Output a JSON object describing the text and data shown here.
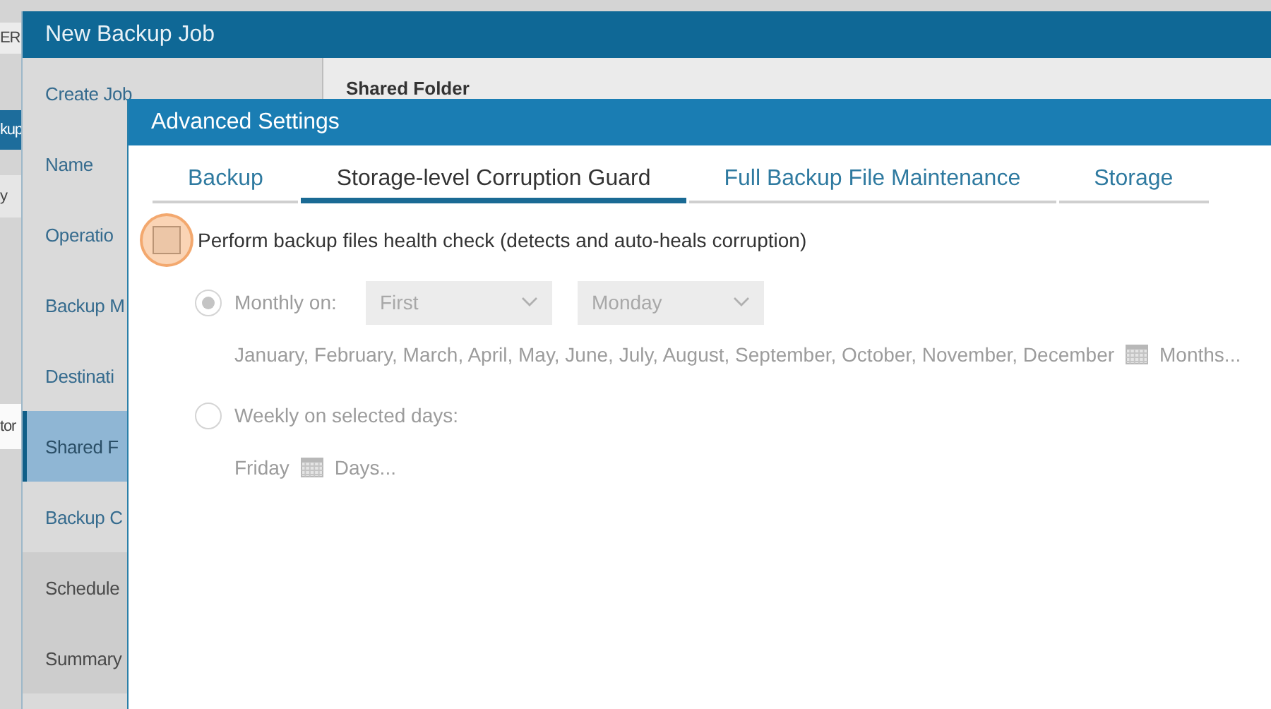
{
  "background_app": {
    "fragments": [
      {
        "text": "ER",
        "kind": "plain"
      },
      {
        "text": "kup",
        "kind": "bar"
      },
      {
        "text": "y",
        "kind": "plain"
      },
      {
        "text": "tor",
        "kind": "field"
      }
    ]
  },
  "job_window": {
    "title": "New Backup Job",
    "section_title": "Shared Folder",
    "steps": [
      {
        "label": "Create Job",
        "selected": false,
        "completed": true
      },
      {
        "label": "Name",
        "selected": false,
        "completed": true
      },
      {
        "label": "Operatio",
        "selected": false,
        "completed": true
      },
      {
        "label": "Backup M",
        "selected": false,
        "completed": true
      },
      {
        "label": "Destinati",
        "selected": false,
        "completed": true
      },
      {
        "label": "Shared F",
        "selected": true,
        "completed": true
      },
      {
        "label": "Backup C",
        "selected": false,
        "completed": true
      },
      {
        "label": "Schedule",
        "selected": false,
        "completed": false
      },
      {
        "label": "Summary",
        "selected": false,
        "completed": false
      }
    ]
  },
  "advanced_settings": {
    "title": "Advanced Settings",
    "tabs": [
      {
        "label": "Backup",
        "selected": false
      },
      {
        "label": "Storage-level Corruption Guard",
        "selected": true
      },
      {
        "label": "Full Backup File Maintenance",
        "selected": false
      },
      {
        "label": "Storage",
        "selected": false
      }
    ],
    "health_check": {
      "label": "Perform backup files health check (detects and auto-heals corruption)",
      "checked": false,
      "highlighted": true
    },
    "schedule_options": [
      {
        "kind": "monthly",
        "label": "Monthly on:",
        "selected": true,
        "disabled": true,
        "dropdowns": [
          {
            "value": "First"
          },
          {
            "value": "Monday"
          }
        ],
        "detail": "January, February, March, April, May, June, July, August, September, October, November, December",
        "link": "Months..."
      },
      {
        "kind": "weekly",
        "label": "Weekly on selected days:",
        "selected": false,
        "disabled": true,
        "detail": "Friday",
        "link": "Days..."
      }
    ]
  }
}
